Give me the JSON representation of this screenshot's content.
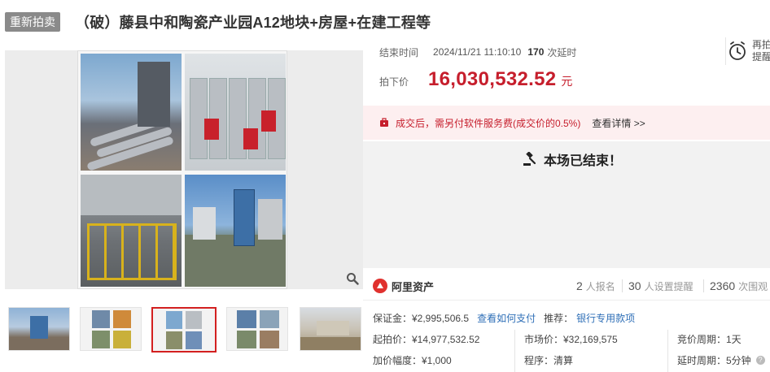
{
  "header": {
    "badge": "重新拍卖",
    "title": "（破）藤县中和陶瓷产业园A12地块+房屋+在建工程等"
  },
  "gallery": {
    "zoom_icon": "magnifier-icon",
    "thumbnails": [
      "thumb-1",
      "thumb-2",
      "thumb-3",
      "thumb-4",
      "thumb-5"
    ],
    "active_index": 2
  },
  "auction": {
    "end_label": "结束时间",
    "end_time": "2024/11/21 11:10:10",
    "delay_count": "170",
    "delay_unit": "次延时",
    "remind_label": "再拍提醒",
    "price_label": "拍下价",
    "price": "16,030,532.52",
    "price_unit": "元"
  },
  "notice": {
    "text": "成交后，需另付软件服务费(成交价的0.5%)",
    "more_link": "查看详情 >>"
  },
  "status": {
    "message": "本场已结束！"
  },
  "stats": {
    "brand": "阿里资产",
    "signup_count": "2",
    "signup_unit": "人报名",
    "reminder_count": "30",
    "reminder_unit": "人设置提醒",
    "view_count": "2360",
    "view_unit": "次围观"
  },
  "info": {
    "deposit": "保证金：¥2,995,506.5",
    "deposit_link": "查看如何支付",
    "recommend_label": "推荐：",
    "recommend_link": "银行专用款项",
    "start_price": "起拍价：¥14,977,532.52",
    "market_price": "市场价：¥32,169,575",
    "bid_period": "竞价周期：1天",
    "increment": "加价幅度：¥1,000",
    "procedure": "程序：清算",
    "delay_period": "延时周期：5分钟"
  },
  "colors": {
    "accent_red": "#c61e2c",
    "link_blue": "#2f6fb7",
    "badge_gray": "#8a8a8a",
    "notice_bg": "#fdeff0",
    "ended_bg": "#f2f2f2"
  }
}
